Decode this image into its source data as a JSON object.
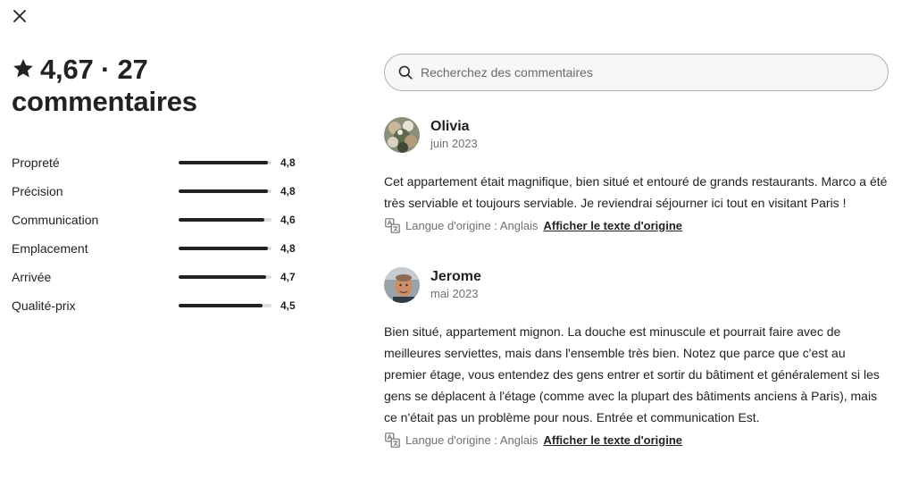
{
  "header": {
    "rating": "4,67",
    "separator": "·",
    "count_text": "27 commentaires"
  },
  "ratings": [
    {
      "label": "Propreté",
      "value": "4,8",
      "score": 4.8
    },
    {
      "label": "Précision",
      "value": "4,8",
      "score": 4.8
    },
    {
      "label": "Communication",
      "value": "4,6",
      "score": 4.6
    },
    {
      "label": "Emplacement",
      "value": "4,8",
      "score": 4.8
    },
    {
      "label": "Arrivée",
      "value": "4,7",
      "score": 4.7
    },
    {
      "label": "Qualité-prix",
      "value": "4,5",
      "score": 4.5
    }
  ],
  "ratings_max": 5,
  "search": {
    "placeholder": "Recherchez des commentaires",
    "value": ""
  },
  "reviews": [
    {
      "name": "Olivia",
      "date": "juin 2023",
      "text": "Cet appartement était magnifique, bien situé et entouré de grands restaurants. Marco a été très serviable et toujours serviable. Je reviendrai séjourner ici tout en visitant Paris !",
      "translation_note": "Langue d'origine : Anglais",
      "translation_link": "Afficher le texte d'origine"
    },
    {
      "name": "Jerome",
      "date": "mai 2023",
      "text": "Bien situé, appartement mignon. La douche est minuscule et pourrait faire avec de meilleures serviettes, mais dans l'ensemble très bien. Notez que parce que c'est au premier étage, vous entendez des gens entrer et sortir du bâtiment et généralement si les gens se déplacent à l'étage (comme avec la plupart des bâtiments anciens à Paris), mais ce n'était pas un problème pour nous. Entrée et communication Est.",
      "translation_note": "Langue d'origine : Anglais",
      "translation_link": "Afficher le texte d'origine"
    }
  ],
  "icons": {
    "close": "close-icon",
    "star": "star-icon",
    "search": "search-icon",
    "translate": "translate-icon"
  },
  "colors": {
    "text": "#222222",
    "muted": "#717171",
    "track": "#dddddd",
    "search_bg": "#f7f7f7"
  }
}
